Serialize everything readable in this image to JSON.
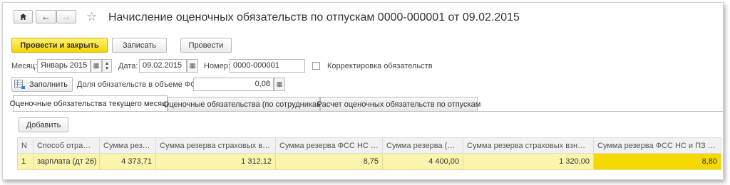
{
  "header": {
    "title": "Начисление оценочных обязательств по отпускам 0000-000001 от 09.02.2015"
  },
  "toolbar": {
    "post_and_close": "Провести и закрыть",
    "save": "Записать",
    "post": "Провести"
  },
  "form": {
    "month_label": "Месяц:",
    "month_value": "Январь 2015",
    "date_label": "Дата:",
    "date_value": "09.02.2015",
    "number_label": "Номер:",
    "number_value": "0000-000001",
    "adjust_label": "Корректировка обязательств",
    "fill_button": "Заполнить",
    "share_label": "Доля обязательств в объеме ФОТ:",
    "share_value": "0,08"
  },
  "tabs": [
    {
      "label": "Оценочные обязательства текущего месяца",
      "active": true
    },
    {
      "label": "Оценочные обязательства (по сотрудникам)",
      "active": false
    },
    {
      "label": "Расчет оценочных обязательств по отпускам",
      "active": false
    }
  ],
  "table": {
    "add_button": "Добавить",
    "columns": [
      "N",
      "Способ отражения",
      "Сумма резерва",
      "Сумма резерва страховых взносов",
      "Сумма резерва ФСС НС и ПЗ",
      "Сумма резерва (НУ)",
      "Сумма резерва страховых взносов...",
      "Сумма резерва ФСС НС и ПЗ (НУ)"
    ],
    "rows": [
      [
        "1",
        "зарплата (дт 26)",
        "4 373,71",
        "1 312,12",
        "8,75",
        "4 400,00",
        "1 320,00",
        "8,80"
      ]
    ]
  }
}
